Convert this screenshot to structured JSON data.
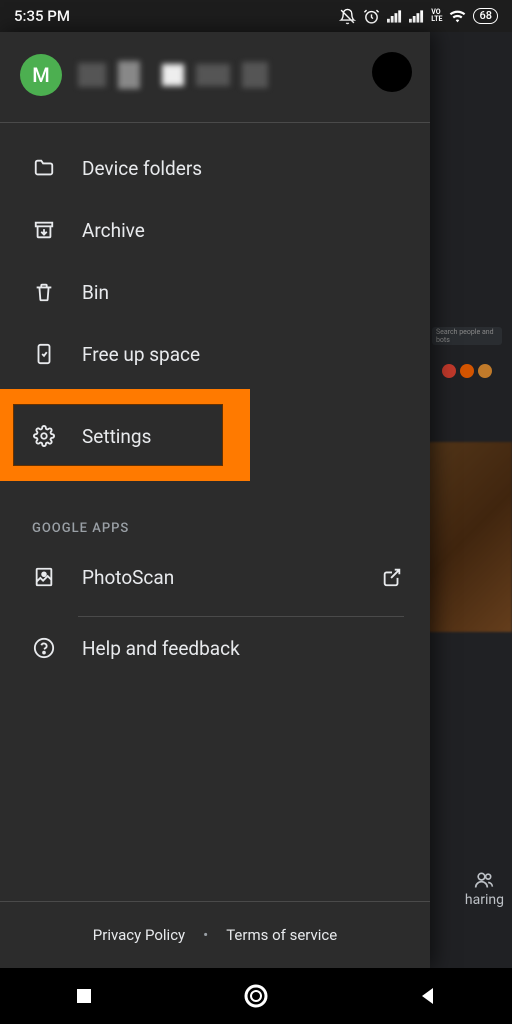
{
  "status": {
    "time": "5:35 PM",
    "battery": "68",
    "volte": "VO\nLTE"
  },
  "account": {
    "initial": "M"
  },
  "menu": {
    "device_folders": "Device folders",
    "archive": "Archive",
    "bin": "Bin",
    "free_up_space": "Free up space",
    "settings": "Settings"
  },
  "section": {
    "google_apps": "GOOGLE APPS"
  },
  "apps": {
    "photoscan": "PhotoScan"
  },
  "help": {
    "label": "Help and feedback"
  },
  "footer": {
    "privacy": "Privacy Policy",
    "terms": "Terms of service"
  },
  "bg": {
    "sharing": "haring",
    "search_hint": "Search people and bots"
  }
}
